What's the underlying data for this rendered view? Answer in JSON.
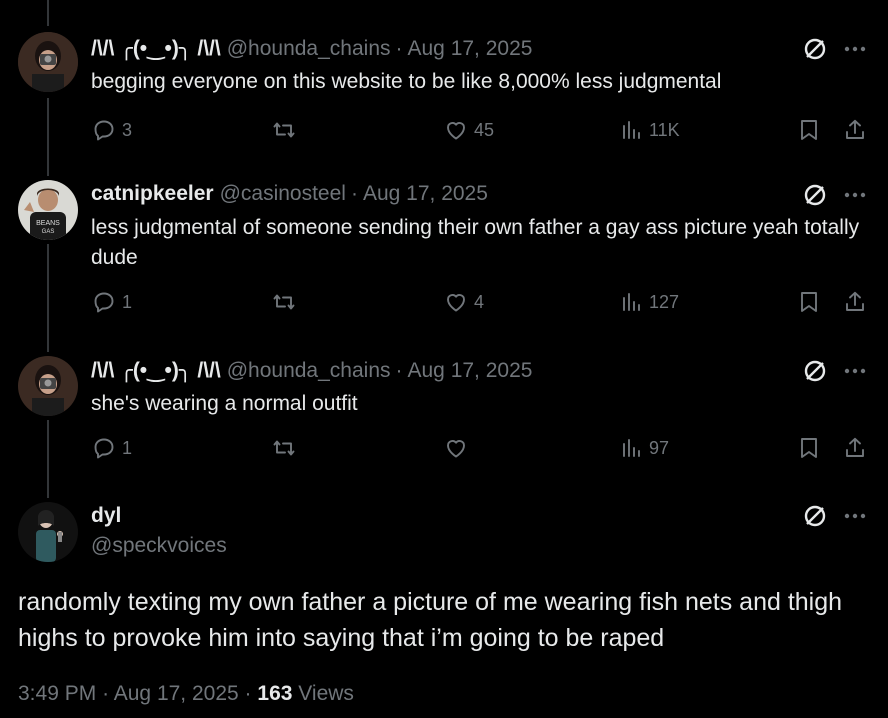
{
  "tweets": [
    {
      "display_name": "/\\/\\ ╭(•‿•)╮ /\\/\\",
      "handle": "@hounda_chains",
      "separator": "·",
      "date": "Aug 17, 2025",
      "text": "begging everyone on this website to be like 8,000% less judgmental",
      "replies": "3",
      "reposts": "",
      "likes": "45",
      "views": "11K"
    },
    {
      "display_name": "catnipkeeler",
      "handle": "@casinosteel",
      "separator": "·",
      "date": "Aug 17, 2025",
      "text": "less judgmental of someone sending their own father a gay ass picture yeah totally dude",
      "replies": "1",
      "reposts": "",
      "likes": "4",
      "views": "127"
    },
    {
      "display_name": "/\\/\\ ╭(•‿•)╮ /\\/\\",
      "handle": "@hounda_chains",
      "separator": "·",
      "date": "Aug 17, 2025",
      "text": "she's wearing a normal outfit",
      "replies": "1",
      "reposts": "",
      "likes": "",
      "views": "97"
    }
  ],
  "main_tweet": {
    "display_name": "dyl",
    "handle": "@speckvoices",
    "text": "randomly texting my own father a picture of me wearing fish nets and thigh highs to provoke him into saying that i’m going to be raped",
    "time": "3:49 PM",
    "separator": "·",
    "date": "Aug 17, 2025",
    "views_count": "163",
    "views_label": "Views"
  },
  "icons": {
    "reply": "reply-icon",
    "repost": "repost-icon",
    "like": "heart-icon",
    "views": "views-icon",
    "bookmark": "bookmark-icon",
    "share": "share-icon",
    "grok": "grok-icon",
    "more": "more-icon"
  },
  "colors": {
    "background": "#000000",
    "text": "#e7e9ea",
    "muted": "#71767b",
    "thread_line": "#333639"
  }
}
